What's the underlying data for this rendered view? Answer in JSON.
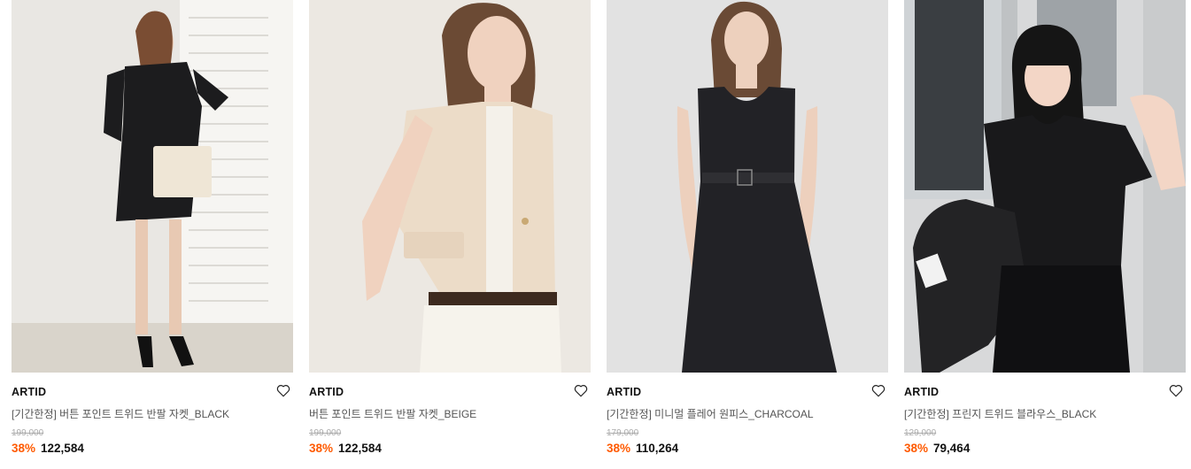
{
  "products": [
    {
      "brand": "ARTID",
      "name": "[기간한정] 버튼 포인트 트위드 반팔 자켓_BLACK",
      "original_price": "199,000",
      "discount": "38%",
      "price": "122,584",
      "colors": {
        "bg": "#e9e7e3",
        "garment": "#1c1c1e"
      }
    },
    {
      "brand": "ARTID",
      "name": "버튼 포인트 트위드 반팔 자켓_BEIGE",
      "original_price": "199,000",
      "discount": "38%",
      "price": "122,584",
      "colors": {
        "bg": "#ece8e2",
        "garment": "#ecdcc8"
      }
    },
    {
      "brand": "ARTID",
      "name": "[기간한정] 미니멀 플레어 원피스_CHARCOAL",
      "original_price": "179,000",
      "discount": "38%",
      "price": "110,264",
      "colors": {
        "bg": "#e2e2e2",
        "garment": "#222226"
      }
    },
    {
      "brand": "ARTID",
      "name": "[기간한정] 프린지 트위드 블라우스_BLACK",
      "original_price": "129,000",
      "discount": "38%",
      "price": "79,464",
      "colors": {
        "bg": "#d8d9da",
        "garment": "#19191b"
      }
    }
  ],
  "icons": {
    "wishlist": "heart-outline-icon"
  },
  "accent": {
    "discount_color": "#ff5a00"
  }
}
